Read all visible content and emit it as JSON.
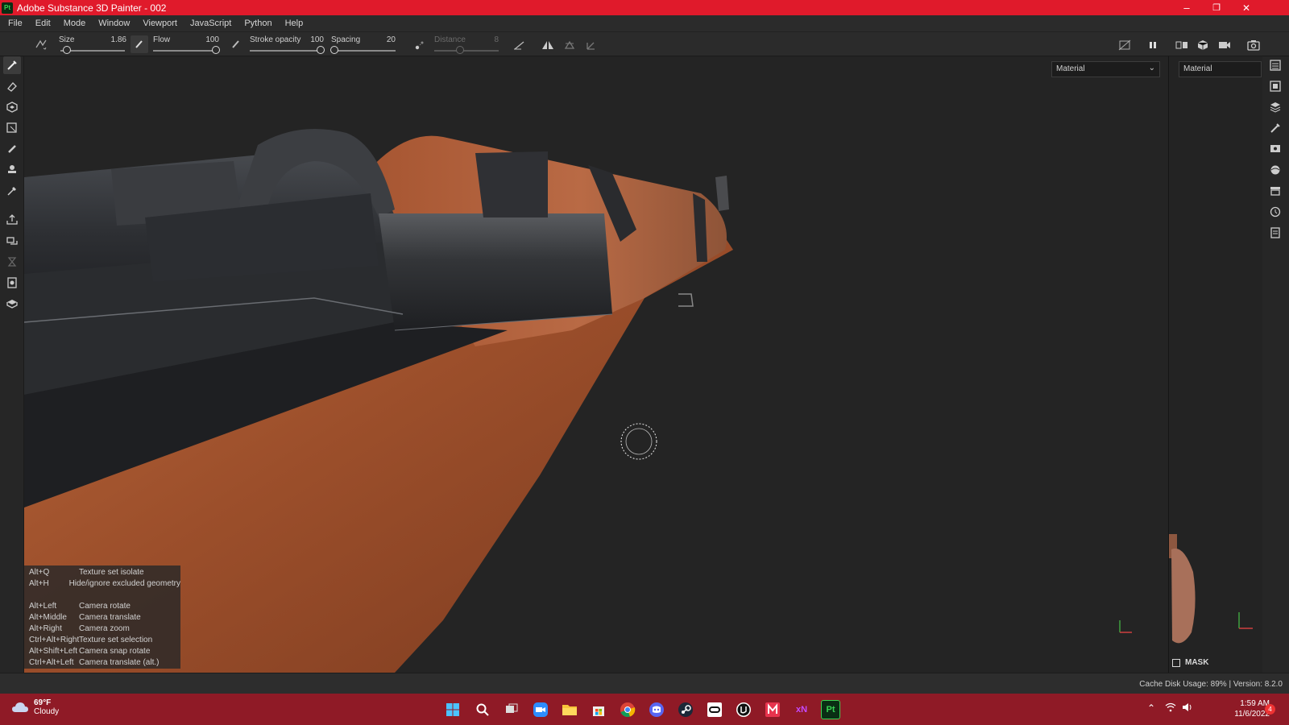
{
  "window": {
    "title": "Adobe Substance 3D Painter - 002",
    "app_badge": "Pt",
    "controls": {
      "minimize": "–",
      "restore": "❐",
      "close": "✕"
    }
  },
  "menu": [
    "File",
    "Edit",
    "Mode",
    "Window",
    "Viewport",
    "JavaScript",
    "Python",
    "Help"
  ],
  "tool_options": {
    "size": {
      "label": "Size",
      "value": "1.86",
      "fraction": 0.1
    },
    "flow": {
      "label": "Flow",
      "value": "100",
      "fraction": 1.0
    },
    "stroke_opacity": {
      "label": "Stroke opacity",
      "value": "100",
      "fraction": 1.0
    },
    "spacing": {
      "label": "Spacing",
      "value": "20",
      "fraction": 0.05
    },
    "distance": {
      "label": "Distance",
      "value": "8",
      "fraction": 0.4
    }
  },
  "viewport": {
    "material_mode": "Material",
    "shortcuts": [
      {
        "key": "Alt+Q",
        "action": "Texture set isolate"
      },
      {
        "key": "Alt+H",
        "action": "Hide/ignore excluded geometry"
      },
      {
        "key": "",
        "action": ""
      },
      {
        "key": "Alt+Left",
        "action": "Camera rotate"
      },
      {
        "key": "Alt+Middle",
        "action": "Camera translate"
      },
      {
        "key": "Alt+Right",
        "action": "Camera zoom"
      },
      {
        "key": "Ctrl+Alt+Right",
        "action": "Texture set selection"
      },
      {
        "key": "Alt+Shift+Left",
        "action": "Camera snap rotate"
      },
      {
        "key": "Ctrl+Alt+Left",
        "action": "Camera translate (alt.)"
      }
    ]
  },
  "view2d": {
    "material_mode": "Material",
    "mask_label": "MASK"
  },
  "status": {
    "cache": "Cache Disk Usage:   89% | Version: 8.2.0"
  },
  "taskbar": {
    "temperature": "69°F",
    "condition": "Cloudy",
    "time": "1:59 AM",
    "date": "11/6/2022",
    "notification_count": "4",
    "apps": [
      "start",
      "search",
      "task-view",
      "zoom",
      "file-explorer",
      "store",
      "chrome",
      "discord",
      "steam",
      "oculus",
      "unreal",
      "medibang",
      "xnormal",
      "substance-painter"
    ],
    "xn_label": "xN",
    "pt_label": "Pt"
  },
  "colors": {
    "titlebar": "#e01a2b",
    "taskbar": "#8f1a26",
    "wood": "#a0532f",
    "metal": "#2e3033"
  }
}
